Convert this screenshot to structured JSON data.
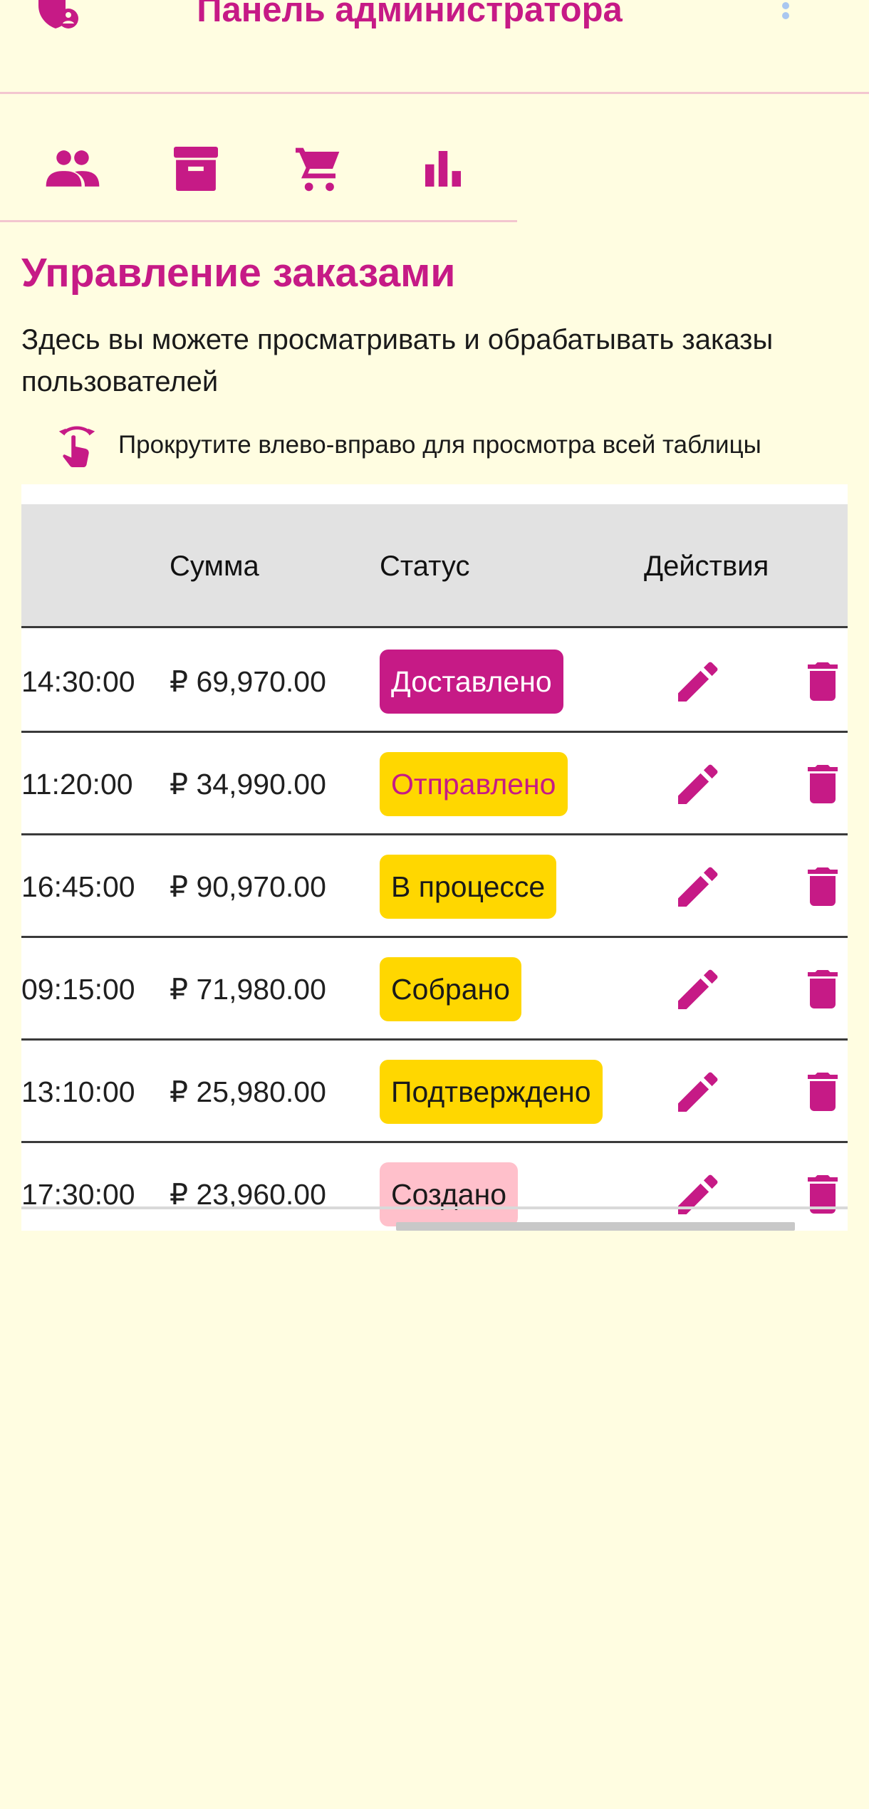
{
  "topbar": {
    "title": "Панель администратора",
    "logo_icon": "admin-shield-icon",
    "menu_icon": "more-vert-icon"
  },
  "tabs": [
    {
      "name": "users",
      "icon": "people-icon"
    },
    {
      "name": "archive",
      "icon": "archive-icon"
    },
    {
      "name": "orders",
      "icon": "cart-icon"
    },
    {
      "name": "stats",
      "icon": "bar-chart-icon"
    }
  ],
  "section": {
    "title": "Управление заказами",
    "description": "Здесь вы можете просматривать и обрабатывать заказы пользователей",
    "hint": "Прокрутите влево-вправо для просмотра всей таблицы",
    "hint_icon": "swipe-icon"
  },
  "table": {
    "headers": {
      "sum": "Сумма",
      "status": "Статус",
      "actions": "Действия"
    },
    "rows": [
      {
        "time": "14:30:00",
        "sum": "₽ 69,970.00",
        "status": "Доставлено"
      },
      {
        "time": "11:20:00",
        "sum": "₽ 34,990.00",
        "status": "Отправлено"
      },
      {
        "time": "16:45:00",
        "sum": "₽ 90,970.00",
        "status": "В процессе"
      },
      {
        "time": "09:15:00",
        "sum": "₽ 71,980.00",
        "status": "Собрано"
      },
      {
        "time": "13:10:00",
        "sum": "₽ 25,980.00",
        "status": "Подтверждено"
      },
      {
        "time": "17:30:00",
        "sum": "₽ 23,960.00",
        "status": "Создано"
      }
    ]
  },
  "colors": {
    "accent": "#C61A86",
    "background": "#FFFDE1",
    "status_delivered_bg": "#C61A86",
    "status_delivered_fg": "#FFFFFF",
    "status_shipped_bg": "#FFD700",
    "status_shipped_fg": "#C61A86",
    "status_processing_bg": "#FFD700",
    "status_processing_fg": "#1a1a1a",
    "status_created_bg": "#FFC0CB",
    "status_created_fg": "#1a1a1a"
  }
}
